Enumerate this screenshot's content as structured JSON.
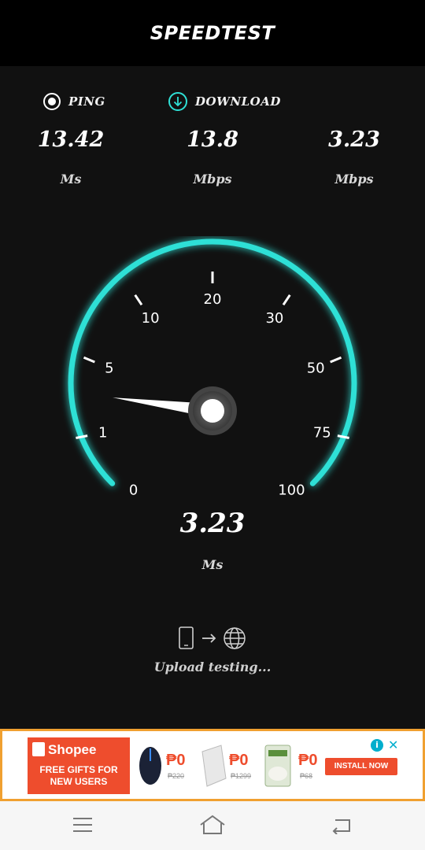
{
  "header": {
    "title": "SPEEDTEST"
  },
  "labels": {
    "ping": "PING",
    "download": "DOWNLOAD"
  },
  "stats": [
    {
      "value": "13.42",
      "unit": "Ms"
    },
    {
      "value": "13.8",
      "unit": "Mbps"
    },
    {
      "value": "3.23",
      "unit": "Mbps"
    }
  ],
  "gauge": {
    "scale_labels": [
      "0",
      "1",
      "5",
      "10",
      "20",
      "30",
      "50",
      "75",
      "100"
    ],
    "needle_reading": 3.23,
    "accent_color": "#2fe0d6"
  },
  "current": {
    "value": "3.23",
    "unit": "Ms"
  },
  "status": {
    "text": "Upload testing..."
  },
  "ad": {
    "brand": "Shopee",
    "promo_line1": "FREE GIFTS FOR",
    "promo_line2": "NEW USERS",
    "products": [
      {
        "price": "₱0",
        "old_price": "₱220"
      },
      {
        "price": "₱0",
        "old_price": "₱1299"
      },
      {
        "price": "₱0",
        "old_price": "₱68"
      }
    ],
    "cta": "INSTALL NOW",
    "brand_color": "#ee4d2d"
  },
  "icons": {
    "ping": "radio-dot-icon",
    "download": "download-arrow-icon",
    "phone": "phone-icon",
    "arrow": "arrow-right-icon",
    "globe": "globe-icon",
    "menu": "menu-icon",
    "home": "home-icon",
    "back": "back-icon"
  }
}
